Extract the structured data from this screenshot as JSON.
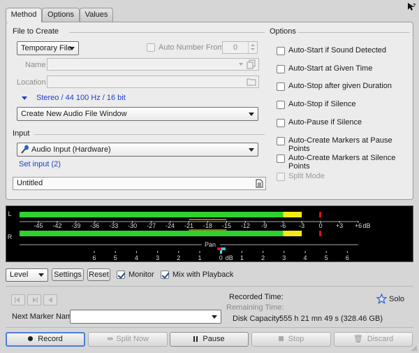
{
  "tabs": [
    {
      "label": "Method",
      "active": true
    },
    {
      "label": "Options",
      "active": false
    },
    {
      "label": "Values",
      "active": false
    }
  ],
  "file_to_create": {
    "title": "File to Create",
    "file_type": "Temporary File",
    "auto_number_label": "Auto Number From",
    "auto_number_value": "0",
    "name_label": "Name",
    "location_label": "Location",
    "format": "Stereo / 44 100 Hz / 16 bit",
    "window_option": "Create New Audio File Window"
  },
  "input": {
    "title": "Input",
    "device": "Audio Input (Hardware)",
    "set_input": "Set input (2)",
    "description": "Untitled"
  },
  "options": {
    "title": "Options",
    "items": [
      {
        "label": "Auto-Start if Sound Detected",
        "checked": false,
        "enabled": true
      },
      {
        "label": "Auto-Start at Given Time",
        "checked": false,
        "enabled": true
      },
      {
        "label": "Auto-Stop after given Duration",
        "checked": false,
        "enabled": true
      },
      {
        "label": "Auto-Stop if Silence",
        "checked": false,
        "enabled": true
      },
      {
        "label": "Auto-Pause if Silence",
        "checked": false,
        "enabled": true
      },
      {
        "label": "Auto-Create Markers at Pause Points",
        "checked": false,
        "enabled": true
      },
      {
        "label": "Auto-Create Markers at Silence Points",
        "checked": false,
        "enabled": true
      },
      {
        "label": "Split Mode",
        "checked": false,
        "enabled": false
      }
    ]
  },
  "meter": {
    "left_label": "L",
    "right_label": "R",
    "db_ticks": [
      "-45",
      "-42",
      "-39",
      "-36",
      "-33",
      "-30",
      "-27",
      "-24",
      "-21",
      "-18",
      "-15",
      "-12",
      "-9",
      "-6",
      "-3",
      "0",
      "+3",
      "+6"
    ],
    "db_unit": "dB",
    "pan_label": "Pan",
    "pan_ticks": [
      "6",
      "5",
      "4",
      "3",
      "2",
      "1",
      "0",
      "1",
      "2",
      "3",
      "4",
      "5",
      "6"
    ],
    "pan_db_label": "dB",
    "left_level_db": -3,
    "right_level_db": -3,
    "left_peak_db": 0,
    "right_peak_db": 0,
    "colors": {
      "green": "#2fd12f",
      "yellow": "#f5e90f",
      "red": "#e01414",
      "olive": "#8a7a10"
    }
  },
  "controls": {
    "mode": "Level",
    "settings": "Settings",
    "reset": "Reset",
    "monitor": "Monitor",
    "monitor_checked": true,
    "mix": "Mix with Playback",
    "mix_checked": true
  },
  "status": {
    "recorded_time_label": "Recorded Time:",
    "remaining_time_label": "Remaining Time:",
    "disk_capacity_label": "Disk Capacity:",
    "disk_capacity_value": "555 h 21 mn 49 s (328.46 GB)",
    "solo": "Solo"
  },
  "marker": {
    "label": "Next Marker Name",
    "value": ""
  },
  "actions": {
    "record": "Record",
    "split_now": "Split Now",
    "pause": "Pause",
    "stop": "Stop",
    "discard": "Discard"
  }
}
